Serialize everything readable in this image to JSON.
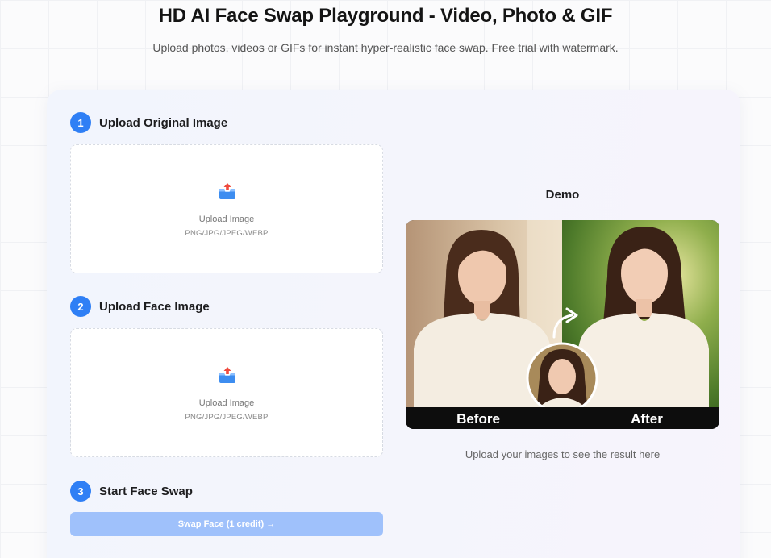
{
  "header": {
    "title": "HD AI Face Swap Playground - Video, Photo & GIF",
    "subtitle": "Upload photos, videos or GIFs for instant hyper-realistic face swap. Free trial with watermark."
  },
  "steps": [
    {
      "number": "1",
      "label": "Upload Original Image"
    },
    {
      "number": "2",
      "label": "Upload Face Image"
    },
    {
      "number": "3",
      "label": "Start Face Swap"
    }
  ],
  "upload_original": {
    "label": "Upload Image",
    "formats": "PNG/JPG/JPEG/WEBP",
    "icon": "upload-tray-icon"
  },
  "upload_face": {
    "label": "Upload Image",
    "formats": "PNG/JPG/JPEG/WEBP",
    "icon": "upload-tray-icon"
  },
  "swap_button": {
    "label": "Swap Face (1 credit) →",
    "state": "disabled"
  },
  "demo": {
    "title": "Demo",
    "before_label": "Before",
    "after_label": "After",
    "caption": "Upload your images to see the result here"
  },
  "colors": {
    "accent": "#2f7ff5",
    "button_disabled": "#9fc1fb"
  }
}
